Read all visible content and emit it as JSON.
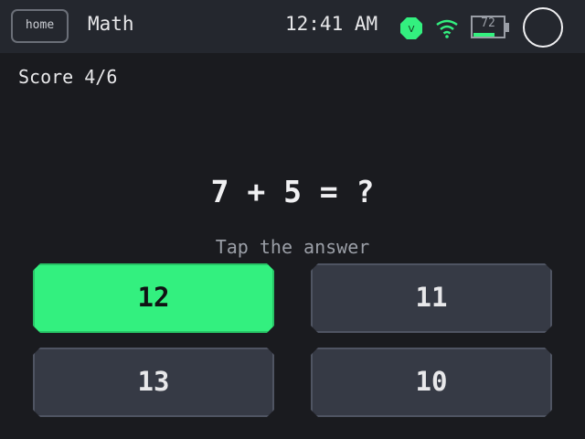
{
  "header": {
    "home_label": "home",
    "app_title": "Math",
    "time": "12:41 AM",
    "vpn_letter": "V",
    "battery_percent": "72",
    "battery_level": 0.72
  },
  "game": {
    "score": "Score 4/6",
    "question": "7 + 5 = ?",
    "hint": "Tap the answer",
    "answers": [
      {
        "label": "12",
        "selected": true
      },
      {
        "label": "11",
        "selected": false
      },
      {
        "label": "13",
        "selected": false
      },
      {
        "label": "10",
        "selected": false
      }
    ]
  },
  "colors": {
    "accent_green": "#33f07f",
    "background": "#1a1b1f",
    "topbar": "#24272e",
    "button": "#363a45"
  }
}
